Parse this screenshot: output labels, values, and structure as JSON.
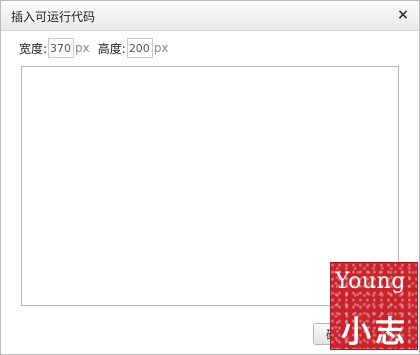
{
  "dialog": {
    "title": "插入可运行代码",
    "close_symbol": "×"
  },
  "size": {
    "width_label": "宽度:",
    "width_value": "370",
    "height_label": "高度:",
    "height_value": "200",
    "unit": "px"
  },
  "code": {
    "value": ""
  },
  "buttons": {
    "ok_label": "确定"
  },
  "watermark": {
    "line1": "Young",
    "line2": "小志",
    "color": "#c8222b"
  }
}
